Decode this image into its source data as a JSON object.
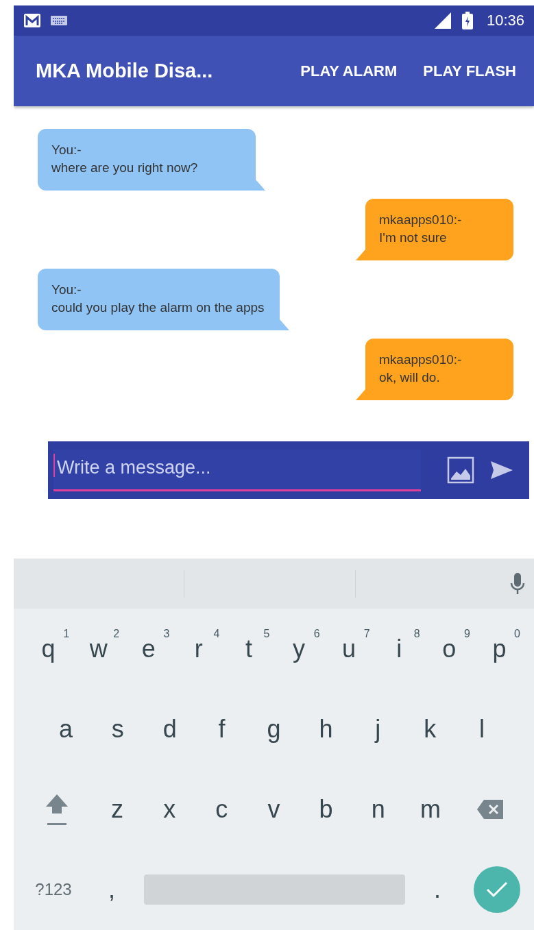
{
  "status_bar": {
    "time": "10:36"
  },
  "app_bar": {
    "title": "MKA Mobile Disa...",
    "actions": [
      "PLAY ALARM",
      "PLAY FLASH"
    ]
  },
  "messages": [
    {
      "kind": "received",
      "sender": "You:-",
      "text": "where are you right now?"
    },
    {
      "kind": "sent",
      "sender": "mkaapps010:-",
      "text": "I'm not sure"
    },
    {
      "kind": "received",
      "sender": "You:-",
      "text": "could you play the alarm on the apps"
    },
    {
      "kind": "sent",
      "sender": "mkaapps010:-",
      "text": "ok, will do."
    }
  ],
  "composer": {
    "placeholder": "Write a message..."
  },
  "keyboard": {
    "rows": [
      [
        {
          "label": "q",
          "hint": "1"
        },
        {
          "label": "w",
          "hint": "2"
        },
        {
          "label": "e",
          "hint": "3"
        },
        {
          "label": "r",
          "hint": "4"
        },
        {
          "label": "t",
          "hint": "5"
        },
        {
          "label": "y",
          "hint": "6"
        },
        {
          "label": "u",
          "hint": "7"
        },
        {
          "label": "i",
          "hint": "8"
        },
        {
          "label": "o",
          "hint": "9"
        },
        {
          "label": "p",
          "hint": "0"
        }
      ],
      [
        {
          "label": "a"
        },
        {
          "label": "s"
        },
        {
          "label": "d"
        },
        {
          "label": "f"
        },
        {
          "label": "g"
        },
        {
          "label": "h"
        },
        {
          "label": "j"
        },
        {
          "label": "k"
        },
        {
          "label": "l"
        }
      ],
      [
        {
          "kind": "shift"
        },
        {
          "label": "z"
        },
        {
          "label": "x"
        },
        {
          "label": "c"
        },
        {
          "label": "v"
        },
        {
          "label": "b"
        },
        {
          "label": "n"
        },
        {
          "label": "m"
        },
        {
          "kind": "backspace"
        }
      ],
      [
        {
          "kind": "symbols",
          "label": "?123"
        },
        {
          "label": ","
        },
        {
          "kind": "space"
        },
        {
          "label": "."
        },
        {
          "kind": "done"
        }
      ]
    ]
  }
}
